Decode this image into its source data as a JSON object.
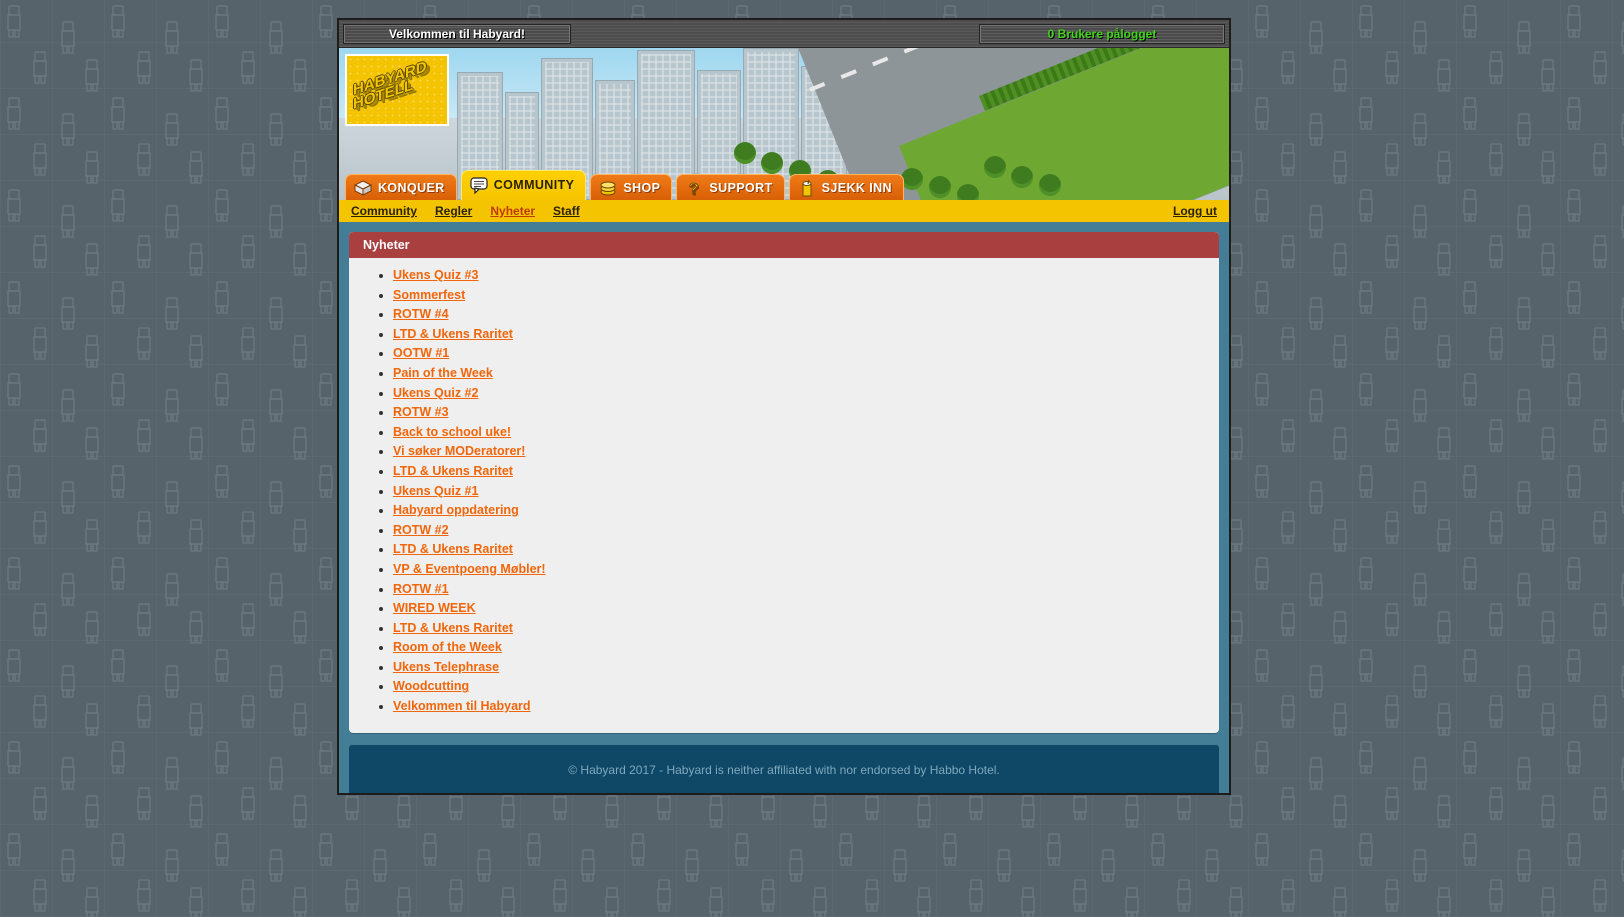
{
  "window": {
    "title_bar": {
      "welcome_text": "Velkommen til Habyard!",
      "users_online_text": "0 Brukere pålogget"
    }
  },
  "banner": {
    "logo_line1": "HABYARD",
    "logo_line2": "HOTELL",
    "scene_description": "isometric pixel city with orange hotel towers"
  },
  "nav": {
    "tabs": [
      {
        "label": "KONQUER",
        "icon": "house-icon",
        "active": false
      },
      {
        "label": "COMMUNITY",
        "icon": "speech-bubble-icon",
        "active": true
      },
      {
        "label": "SHOP",
        "icon": "coins-icon",
        "active": false
      },
      {
        "label": "SUPPORT",
        "icon": "question-mark-icon",
        "active": false
      },
      {
        "label": "SJEKK INN",
        "icon": "drink-cup-icon",
        "active": false
      }
    ]
  },
  "subnav": {
    "links": [
      {
        "label": "Community",
        "current": false
      },
      {
        "label": "Regler",
        "current": false
      },
      {
        "label": "Nyheter",
        "current": true
      },
      {
        "label": "Staff",
        "current": false
      }
    ],
    "logout_label": "Logg ut"
  },
  "news": {
    "panel_title": "Nyheter",
    "items": [
      "Ukens Quiz #3",
      "Sommerfest",
      "ROTW #4",
      "LTD & Ukens Raritet",
      "OOTW #1",
      "Pain of the Week",
      "Ukens Quiz #2",
      "ROTW #3",
      "Back to school uke!",
      "Vi søker MODeratorer!",
      "LTD & Ukens Raritet",
      "Ukens Quiz #1",
      "Habyard oppdatering",
      "ROTW #2",
      "LTD & Ukens Raritet",
      "VP & Eventpoeng Møbler!",
      "ROTW #1",
      "WIRED WEEK",
      "LTD & Ukens Raritet",
      "Room of the Week",
      "Ukens Telephrase",
      "Woodcutting",
      "Velkommen til Habyard"
    ]
  },
  "footer": {
    "text": "© Habyard 2017 - Habyard is neither affiliated with nor endorsed by Habbo Hotel."
  },
  "colors": {
    "page_bg": "#56636b",
    "body_blue": "#447e96",
    "panel_header_red": "#a93f3f",
    "link_orange": "#f1660a",
    "tab_orange": "#e06a0a",
    "tab_active_yellow": "#f5c400",
    "footer_navy": "#0e4866",
    "online_green": "#41d41a"
  }
}
